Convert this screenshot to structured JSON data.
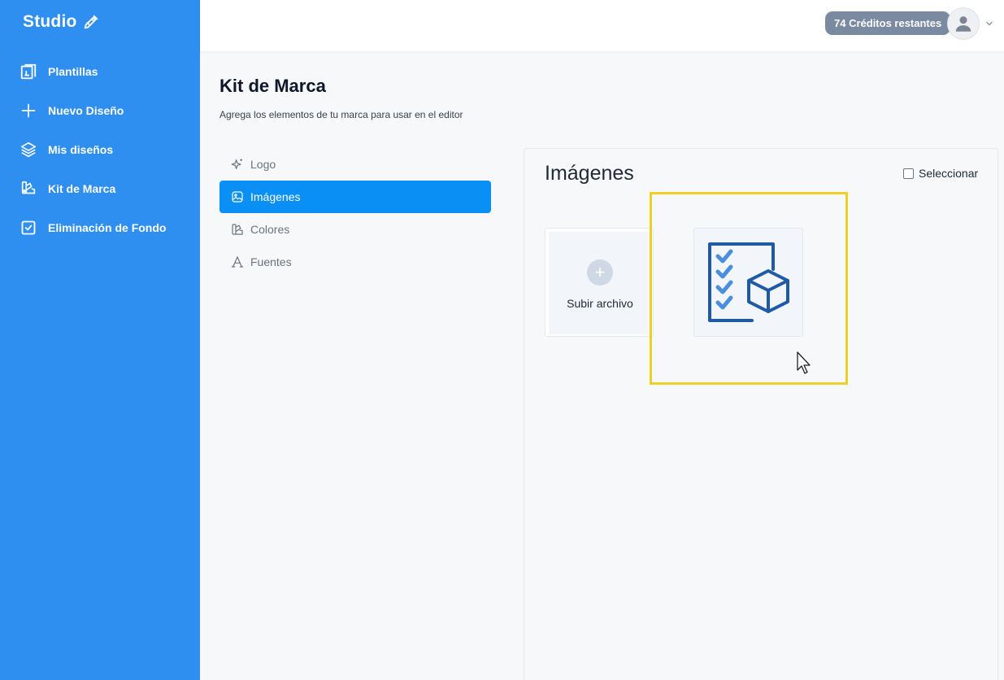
{
  "sidebar": {
    "brand": "Studio",
    "items": [
      {
        "label": "Plantillas",
        "icon": "templates-icon"
      },
      {
        "label": "Nuevo Diseño",
        "icon": "plus-icon"
      },
      {
        "label": "Mis diseños",
        "icon": "layers-icon"
      },
      {
        "label": "Kit de Marca",
        "icon": "brand-kit-icon"
      },
      {
        "label": "Eliminación de Fondo",
        "icon": "checkbox-icon"
      }
    ]
  },
  "header": {
    "credits": "74 Créditos restantes"
  },
  "page": {
    "title": "Kit de Marca",
    "subtitle": "Agrega los elementos de tu marca para usar en el editor"
  },
  "submenu": {
    "items": [
      {
        "label": "Logo",
        "icon": "sparkle-icon"
      },
      {
        "label": "Imágenes",
        "icon": "image-icon",
        "active": true
      },
      {
        "label": "Colores",
        "icon": "palette-icon"
      },
      {
        "label": "Fuentes",
        "icon": "font-icon"
      }
    ]
  },
  "panel": {
    "title": "Imágenes",
    "select_label": "Seleccionar",
    "upload_label": "Subir archivo"
  },
  "colors": {
    "sidebar": "#2e8ff0",
    "active": "#0a8ff5",
    "highlight": "#f0cf24",
    "icon_dark": "#1f5aa6",
    "icon_light": "#4a8fdc"
  }
}
